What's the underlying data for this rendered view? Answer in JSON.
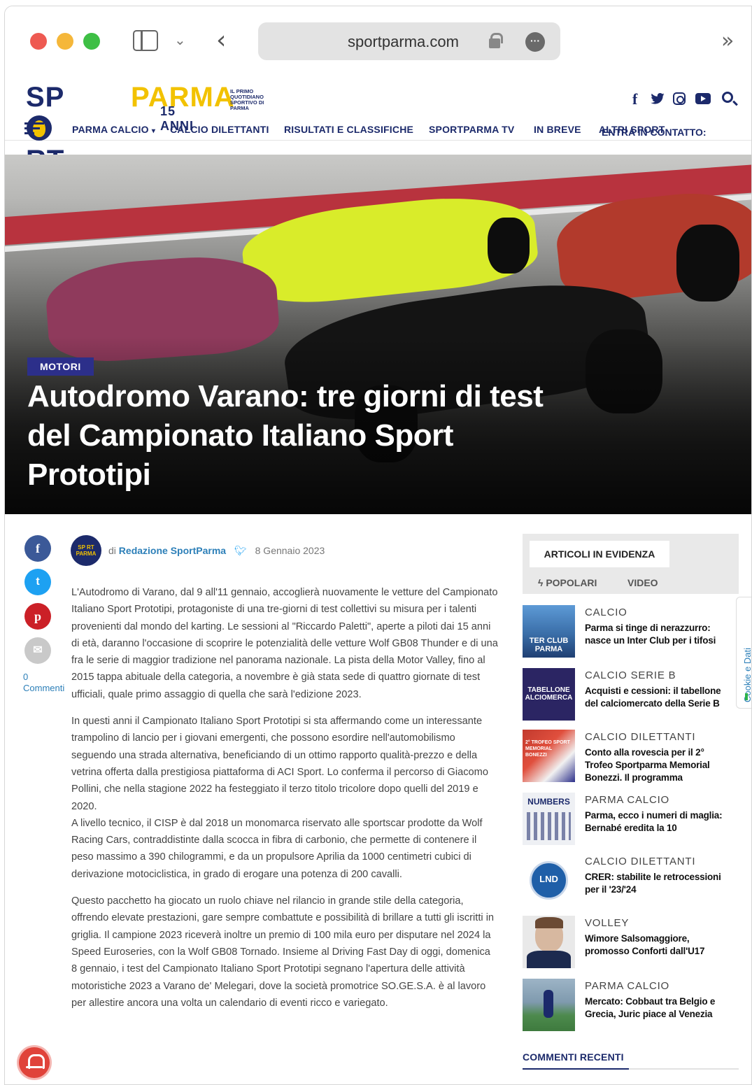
{
  "browser": {
    "url": "sportparma.com"
  },
  "site": {
    "logo_sport": "SP",
    "logo_sport_rest": "RT",
    "logo_parma": "PARMA",
    "logo_anni": "15 ANNI",
    "logo_tagline": "IL PRIMO QUOTIDIANO SPORTIVO DI PARMA",
    "brand_color": "#1c2a6b",
    "accent_color": "#f2c200",
    "socials": [
      "facebook-icon",
      "twitter-icon",
      "instagram-icon",
      "youtube-icon",
      "search-icon"
    ]
  },
  "nav": {
    "items": [
      "PARMA CALCIO",
      "CALCIO DILETTANTI",
      "RISULTATI E CLASSIFICHE",
      "SPORTPARMA TV",
      "IN BREVE",
      "ALTRI SPORT"
    ],
    "parma_caret": "▾",
    "overlay_text": "ENTRA IN CONTATTO:"
  },
  "hero": {
    "category": "MOTORI",
    "title": "Autodromo Varano: tre giorni di test del Campionato Italiano Sport Prototipi"
  },
  "share": {
    "fb": "f",
    "tw": "t",
    "pin": "p",
    "mail": "✉",
    "comments": "0 Commenti"
  },
  "author": {
    "avatar_text": "SP RT PARMA",
    "prefix": "di",
    "name": "Redazione SportParma",
    "date": "8 Gennaio 2023"
  },
  "article": {
    "paragraphs": [
      "L'Autodromo di Varano, dal 9 all'11 gennaio, accoglierà nuovamente le vetture del Campionato Italiano Sport Prototipi, protagoniste di una tre-giorni di test collettivi su misura per i talenti provenienti dal mondo del karting. Le sessioni al \"Riccardo Paletti\", aperte a piloti dai 15 anni di età, daranno l'occasione di scoprire le potenzialità delle vetture Wolf GB08 Thunder e di una fra le serie di maggior tradizione nel panorama nazionale. La pista della Motor Valley, fino al 2015 tappa abituale della categoria, a novembre è già stata sede di quattro giornate di test ufficiali, quale primo assaggio di quella che sarà l'edizione 2023.",
      "In questi anni il Campionato Italiano Sport Prototipi si sta affermando come un interessante trampolino di lancio per i giovani emergenti, che possono esordire nell'automobilismo seguendo una strada alternativa, beneficiando di un ottimo rapporto qualità-prezzo e della vetrina offerta dalla prestigiosa piattaforma di ACI Sport. Lo conferma il percorso di Giacomo Pollini, che nella stagione 2022 ha festeggiato il terzo titolo tricolore dopo quelli del 2019 e 2020.",
      "A livello tecnico, il CISP è dal 2018 un monomarca riservato alle sportscar prodotte da Wolf Racing Cars, contraddistinte dalla scocca in fibra di carbonio, che permette di contenere il peso massimo a 390 chilogrammi, e da un propulsore Aprilia da 1000 centimetri cubici di derivazione motociclistica, in grado di erogare una potenza di 200 cavalli.",
      "Questo pacchetto ha giocato un ruolo chiave nel rilancio in grande stile della categoria, offrendo elevate prestazioni, gare sempre combattute e possibilità di brillare a tutti gli iscritti in griglia. Il campione 2023 riceverà inoltre un premio di 100 mila euro per disputare nel 2024 la Speed Euroseries, con la Wolf GB08 Tornado. Insieme al Driving Fast Day di oggi, domenica 8 gennaio, i test del Campionato Italiano Sport Prototipi segnano l'apertura delle attività motoristiche 2023 a Varano de' Melegari, dove la società promotrice SO.GE.S.A. è al lavoro per allestire ancora una volta un calendario di eventi ricco e variegato."
    ]
  },
  "sidebar": {
    "heading": "ARTICOLI IN EVIDENZA",
    "tab_popular": "POPOLARI",
    "tab_video": "VIDEO",
    "news": [
      {
        "category": "CALCIO",
        "title": "Parma si tinge di nerazzurro: nasce un Inter Club per i tifosi",
        "thumb_text": "TER CLUB PARMA",
        "thumb_color": "#3a6ea8"
      },
      {
        "category": "CALCIO SERIE B",
        "title": "Acquisti e cessioni: il tabellone del calciomercato della Serie B",
        "thumb_text": "TABELLONE ALCIOMERCA",
        "thumb_color": "#2b2563"
      },
      {
        "category": "CALCIO DILETTANTI",
        "title": "Conto alla rovescia per il 2° Trofeo Sportparma Memorial Bonezzi. Il programma",
        "thumb_text": "2° TROFEO SPORT MEMORIAL BONEZZI",
        "thumb_color": "#c23a2e"
      },
      {
        "category": "PARMA CALCIO",
        "title": "Parma, ecco i numeri di maglia: Bernabé eredita la 10",
        "thumb_text": "NUMBERS",
        "thumb_color": "#eef0f4"
      },
      {
        "category": "CALCIO DILETTANTI",
        "title": "CRER: stabilite le retrocessioni per il '23/'24",
        "thumb_text": "LND",
        "thumb_color": "#1f5fa8"
      },
      {
        "category": "VOLLEY",
        "title": "Wimore Salsomaggiore, promosso Conforti dall'U17",
        "thumb_text": "",
        "thumb_color": "#d7b8a0"
      },
      {
        "category": "PARMA CALCIO",
        "title": "Mercato: Cobbaut tra Belgio e Grecia, Juric piace al Venezia",
        "thumb_text": "",
        "thumb_color": "#6e8fa8"
      }
    ],
    "recent_heading": "COMMENTI RECENTI"
  },
  "cookie": {
    "label": "Cookie e Dati"
  }
}
